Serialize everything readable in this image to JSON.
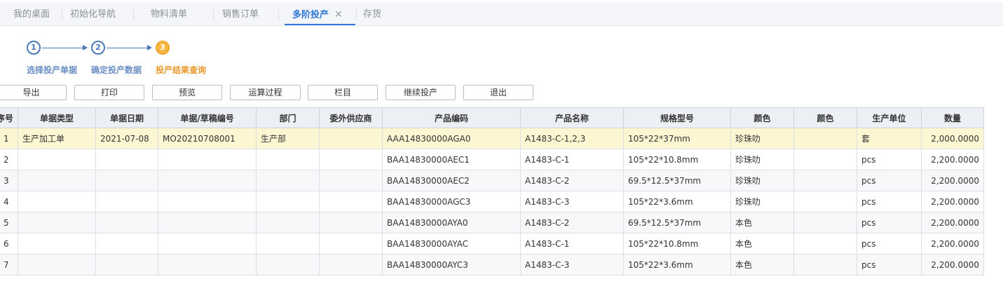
{
  "tabs": [
    {
      "label": "我的桌面"
    },
    {
      "label": "初始化导航"
    },
    {
      "label": "物料清单"
    },
    {
      "label": "销售订单"
    },
    {
      "label": "多阶投产",
      "close": "✕"
    },
    {
      "label": "存货"
    }
  ],
  "steps": [
    {
      "number": "1",
      "label": "选择投产单据"
    },
    {
      "number": "2",
      "label": "确定投产数据"
    },
    {
      "number": "3",
      "label": "投产结果查询"
    }
  ],
  "toolbar": {
    "export": "导出",
    "print": "打印",
    "preview": "预览",
    "calc_process": "运算过程",
    "columns": "栏目",
    "continue": "继续投产",
    "exit": "退出"
  },
  "table": {
    "headers": [
      "序号",
      "单据类型",
      "单据日期",
      "单据/草稿编号",
      "部门",
      "委外供应商",
      "产品编码",
      "产品名称",
      "规格型号",
      "颜色",
      "颜色",
      "生产单位",
      "数量"
    ],
    "rows": [
      [
        "1",
        "生产加工单",
        "2021-07-08",
        "MO20210708001",
        "生产部",
        "",
        "AAA14830000AGA0",
        "A1483-C-1,2,3",
        "105*22*37mm",
        "珍珠叻",
        "",
        "套",
        "2,000.0000"
      ],
      [
        "2",
        "",
        "",
        "",
        "",
        "",
        "BAA14830000AEC1",
        "A1483-C-1",
        "105*22*10.8mm",
        "珍珠叻",
        "",
        "pcs",
        "2,200.0000"
      ],
      [
        "3",
        "",
        "",
        "",
        "",
        "",
        "BAA14830000AEC2",
        "A1483-C-2",
        "69.5*12.5*37mm",
        "珍珠叻",
        "",
        "pcs",
        "2,200.0000"
      ],
      [
        "4",
        "",
        "",
        "",
        "",
        "",
        "BAA14830000AGC3",
        "A1483-C-3",
        "105*22*3.6mm",
        "珍珠叻",
        "",
        "pcs",
        "2,200.0000"
      ],
      [
        "5",
        "",
        "",
        "",
        "",
        "",
        "BAA14830000AYA0",
        "A1483-C-2",
        "69.5*12.5*37mm",
        "本色",
        "",
        "pcs",
        "2,200.0000"
      ],
      [
        "6",
        "",
        "",
        "",
        "",
        "",
        "BAA14830000AYAC",
        "A1483-C-1",
        "105*22*10.8mm",
        "本色",
        "",
        "pcs",
        "2,200.0000"
      ],
      [
        "7",
        "",
        "",
        "",
        "",
        "",
        "BAA14830000AYC3",
        "A1483-C-3",
        "105*22*3.6mm",
        "本色",
        "",
        "pcs",
        "2,200.0000"
      ]
    ]
  },
  "colors": {
    "accent": "#2f78d6",
    "step_done": "#4a78b8",
    "step_current": "#f7b842",
    "selected_row": "#fdf6d3"
  }
}
